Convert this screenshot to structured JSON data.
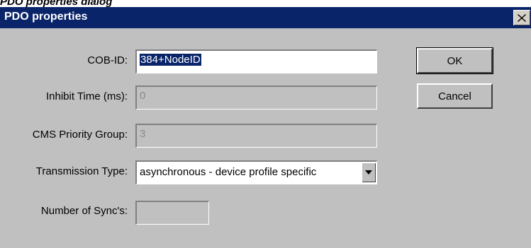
{
  "page_caption": "PDO properties dialog",
  "dialog": {
    "title": "PDO properties",
    "close_symbol": "close-icon"
  },
  "fields": {
    "cob_id": {
      "label": "COB-ID:",
      "value": "384+NodeID"
    },
    "inhibit_time": {
      "label": "Inhibit Time (ms):",
      "value": "0"
    },
    "cms_priority": {
      "label": "CMS Priority Group:",
      "value": "3"
    },
    "transmission_type": {
      "label": "Transmission Type:",
      "value": "asynchronous - device profile specific"
    },
    "number_of_syncs": {
      "label": "Number of Sync's:",
      "value": ""
    }
  },
  "buttons": {
    "ok": "OK",
    "cancel": "Cancel"
  },
  "colors": {
    "titlebar": "#0a246a",
    "dialog_bg": "#c0c0c0",
    "selection": "#0a246a"
  }
}
